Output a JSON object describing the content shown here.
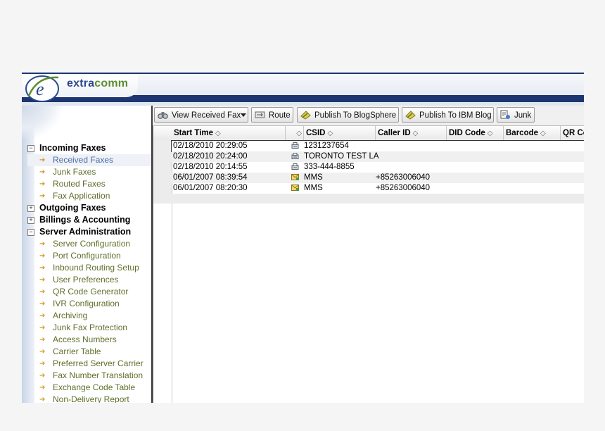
{
  "app": {
    "logo_letter": "e",
    "logo_text_a": "extra",
    "logo_text_b": "comm"
  },
  "colors": {
    "header_stripe": "#1d3570",
    "logo_blue": "#2b4a8b",
    "logo_green": "#5b8e2c",
    "leaf_text": "#5f6f2a",
    "selected_leaf": "#4a6fa8"
  },
  "sidebar": {
    "groups": [
      {
        "label": "Incoming Faxes",
        "toggle": "−",
        "items": [
          "Received Faxes",
          "Junk Faxes",
          "Routed Faxes",
          "Fax Application"
        ]
      },
      {
        "label": "Outgoing Faxes",
        "toggle": "+",
        "items": []
      },
      {
        "label": "Billings & Accounting",
        "toggle": "+",
        "items": []
      },
      {
        "label": "Server Administration",
        "toggle": "−",
        "items": [
          "Server Configuration",
          "Port Configuration",
          "Inbound Routing Setup",
          "User Preferences",
          "QR Code Generator",
          "IVR Configuration",
          "Archiving",
          "Junk Fax Protection",
          "Access Numbers",
          "Carrier Table",
          "Preferred Server Carrier",
          "Fax Number Translation",
          "Exchange Code Table",
          "Non-Delivery Report"
        ]
      }
    ],
    "selected_item": "Received Faxes"
  },
  "toolbar": {
    "view_received": "View Received Fax",
    "view_icon": "binoculars-icon",
    "dropdown_icon": "chevron-down-icon",
    "route": "Route",
    "route_icon": "route-icon",
    "publish_blogsphere": "Publish To BlogSphere",
    "publish_icon": "publish-icon",
    "publish_ibm": "Publish To IBM Blog",
    "junk": "Junk",
    "junk_icon": "junk-icon"
  },
  "table": {
    "headers": {
      "start_time": "Start Time",
      "type": "",
      "csid": "CSID",
      "caller_id": "Caller ID",
      "did_code": "DID Code",
      "barcode": "Barcode",
      "qr_code": "QR Co"
    },
    "sort_glyph": "◇",
    "rows": [
      {
        "start_time": "02/18/2010 20:29:05",
        "type_icon": "fax-icon",
        "csid": "1231237654",
        "caller_id": ""
      },
      {
        "start_time": "02/18/2010 20:24:00",
        "type_icon": "fax-icon",
        "csid": "TORONTO TEST LA",
        "caller_id": ""
      },
      {
        "start_time": "02/18/2010 20:14:55",
        "type_icon": "fax-icon",
        "csid": "333-444-8855",
        "caller_id": ""
      },
      {
        "start_time": "06/01/2007 08:39:54",
        "type_icon": "mms-icon",
        "csid": "MMS",
        "caller_id": "+85263006040"
      },
      {
        "start_time": "06/01/2007 08:20:30",
        "type_icon": "mms-icon",
        "csid": "MMS",
        "caller_id": "+85263006040"
      }
    ]
  }
}
